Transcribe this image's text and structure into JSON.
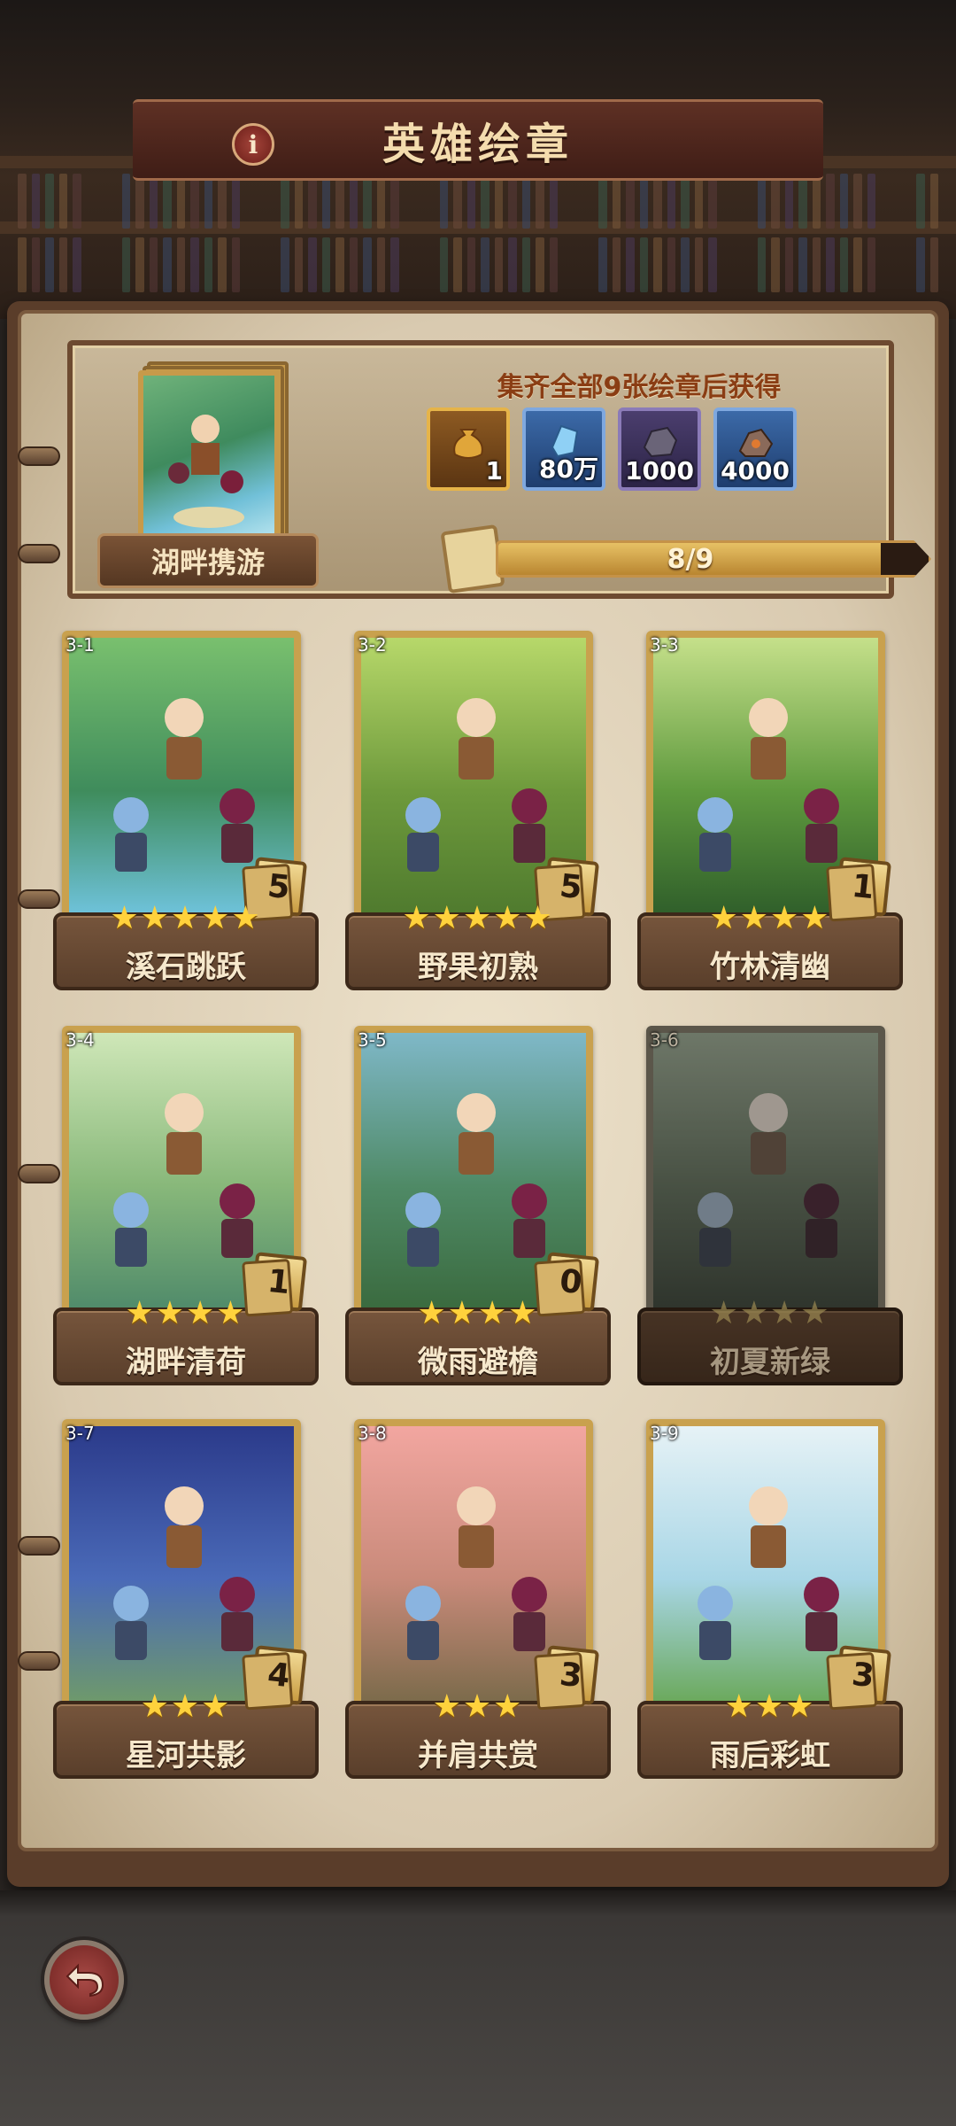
{
  "title": "英雄绘章",
  "info_icon": "i",
  "reward": {
    "heading": "集齐全部9张绘章后获得",
    "collection_name": "湖畔携游",
    "items": [
      {
        "icon": "gold-pouch-icon",
        "amount": "1",
        "style": "gold"
      },
      {
        "icon": "blue-crystal-icon",
        "amount": "80万",
        "style": "blue"
      },
      {
        "icon": "ore-icon",
        "amount": "1000",
        "style": "purple"
      },
      {
        "icon": "ember-ore-icon",
        "amount": "4000",
        "style": "blue"
      }
    ],
    "progress_text": "8/9",
    "progress_fraction": 0.8889
  },
  "cards": [
    {
      "id": "3-1",
      "title": "溪石跳跃",
      "stars": "★★★★★",
      "count": "5",
      "locked": false,
      "colors": [
        "#79c06e",
        "#3f8c5c",
        "#6fc3dc"
      ]
    },
    {
      "id": "3-2",
      "title": "野果初熟",
      "stars": "★★★★★",
      "count": "5",
      "locked": false,
      "colors": [
        "#b7d86a",
        "#6e9a3c",
        "#4f7a2e"
      ]
    },
    {
      "id": "3-3",
      "title": "竹林清幽",
      "stars": "★★★★",
      "count": "1",
      "locked": false,
      "colors": [
        "#c5e08a",
        "#5f9a3e",
        "#2f5e2a"
      ]
    },
    {
      "id": "3-4",
      "title": "湖畔清荷",
      "stars": "★★★★",
      "count": "1",
      "locked": false,
      "colors": [
        "#cfe7b8",
        "#88b87a",
        "#4f8a6a"
      ]
    },
    {
      "id": "3-5",
      "title": "微雨避檐",
      "stars": "★★★★",
      "count": "0",
      "locked": false,
      "colors": [
        "#7fb8c8",
        "#4f8a66",
        "#3a6a3e"
      ]
    },
    {
      "id": "3-6",
      "title": "初夏新绿",
      "stars": "★★★★",
      "count": "",
      "locked": true,
      "colors": [
        "#8fb07a",
        "#5a7a4a",
        "#3a4e32"
      ]
    },
    {
      "id": "3-7",
      "title": "星河共影",
      "stars": "★★★",
      "count": "4",
      "locked": false,
      "colors": [
        "#2b3a8a",
        "#4a6ab8",
        "#6f9a6a"
      ]
    },
    {
      "id": "3-8",
      "title": "并肩共赏",
      "stars": "★★★",
      "count": "3",
      "locked": false,
      "colors": [
        "#f2a6a0",
        "#c98a7a",
        "#7a6a4a"
      ]
    },
    {
      "id": "3-9",
      "title": "雨后彩虹",
      "stars": "★★★",
      "count": "3",
      "locked": false,
      "colors": [
        "#e6f2f6",
        "#a8d6e6",
        "#6aa85a"
      ]
    }
  ]
}
